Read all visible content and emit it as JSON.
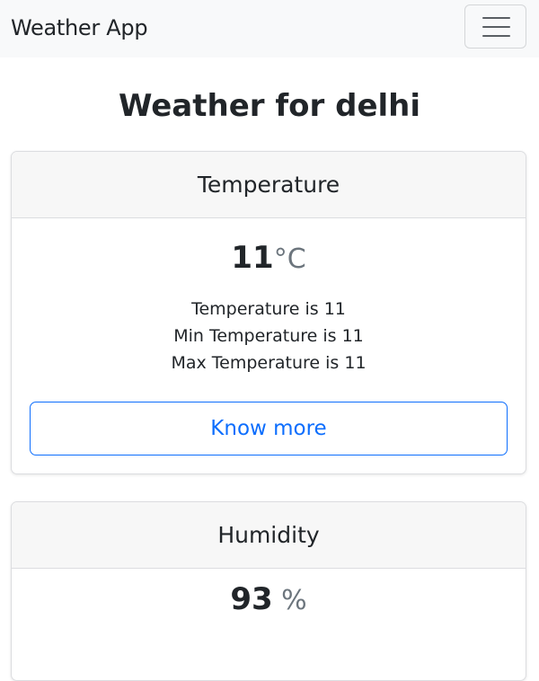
{
  "navbar": {
    "brand": "Weather App",
    "toggler_icon": "hamburger-menu-icon"
  },
  "page": {
    "title": "Weather for delhi"
  },
  "temperature_card": {
    "header": "Temperature",
    "value": "11",
    "unit": "°C",
    "lines": [
      "Temperature is 11",
      "Min Temperature is 11",
      "Max Temperature is 11"
    ],
    "button_label": "Know more"
  },
  "humidity_card": {
    "header": "Humidity",
    "value": "93",
    "unit": " %"
  },
  "colors": {
    "primary": "#0d6efd",
    "navbar_bg": "#f8f9fa",
    "card_header_bg": "#f7f7f7",
    "muted_text": "#6c757d"
  }
}
